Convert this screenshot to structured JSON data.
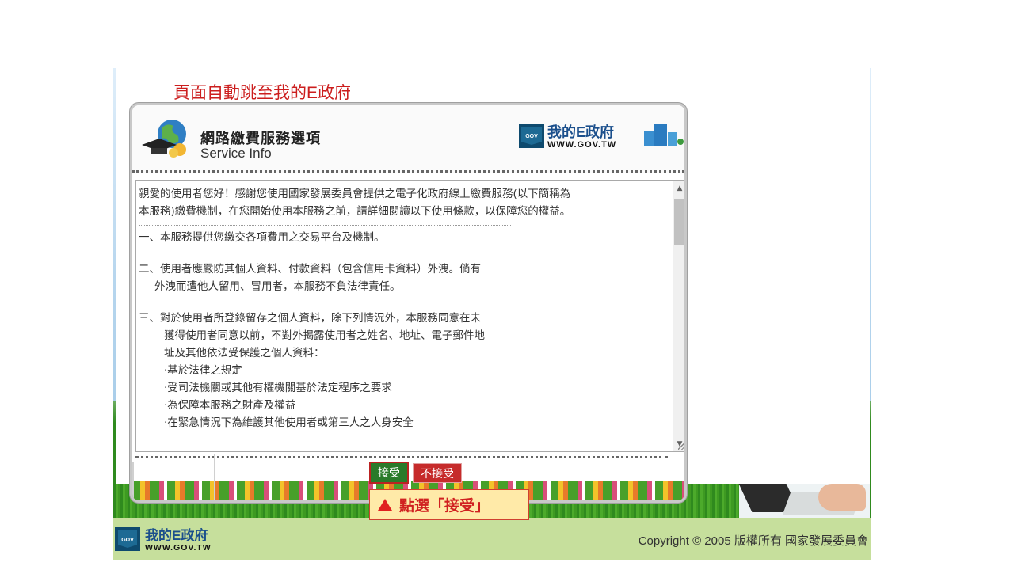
{
  "redirect_title": "頁面自動跳至我的E政府",
  "dialog": {
    "title_cn": "網路繳費服務選項",
    "title_en": "Service Info",
    "logo_text": "我的E政府",
    "logo_url": "WWW.GOV.TW",
    "logo_badge": "GOV"
  },
  "terms": {
    "intro": [
      "親愛的使用者您好！感謝您使用國家發展委員會提供之電子化政府線上繳費服務(以下簡稱為",
      "本服務)繳費機制，在您開始使用本服務之前，請詳細閱讀以下使用條款，以保障您的權益。"
    ],
    "item1": "一、本服務提供您繳交各項費用之交易平台及機制。",
    "item2": [
      "二、使用者應嚴防其個人資料、付款資料（包含信用卡資料）外洩。倘有",
      "外洩而遭他人留用、冒用者，本服務不負法律責任。"
    ],
    "item3": [
      "三、對於使用者所登錄留存之個人資料，除下列情況外，本服務同意在未",
      "獲得使用者同意以前，不對外揭露使用者之姓名、地址、電子郵件地",
      "址及其他依法受保護之個人資料："
    ],
    "item3_bullets": [
      "‧基於法律之規定",
      "‧受司法機關或其他有權機關基於法定程序之要求",
      "‧為保障本服務之財產及權益",
      "‧在緊急情況下為維護其他使用者或第三人之人身安全"
    ]
  },
  "buttons": {
    "accept": "接受",
    "reject": "不接受"
  },
  "annotation": "點選「接受」",
  "footer": {
    "logo_text": "我的E政府",
    "logo_url": "WWW.GOV.TW",
    "logo_badge": "GOV",
    "copyright": "Copyright © 2005 版權所有 國家發展委員會"
  },
  "colors": {
    "redirect_title": "#cc1e1e",
    "accept_bg": "#2a7a2a",
    "reject_bg": "#c62b2b",
    "annotation_bg": "#ffeaa8",
    "footer_bg": "#c6df9c"
  }
}
